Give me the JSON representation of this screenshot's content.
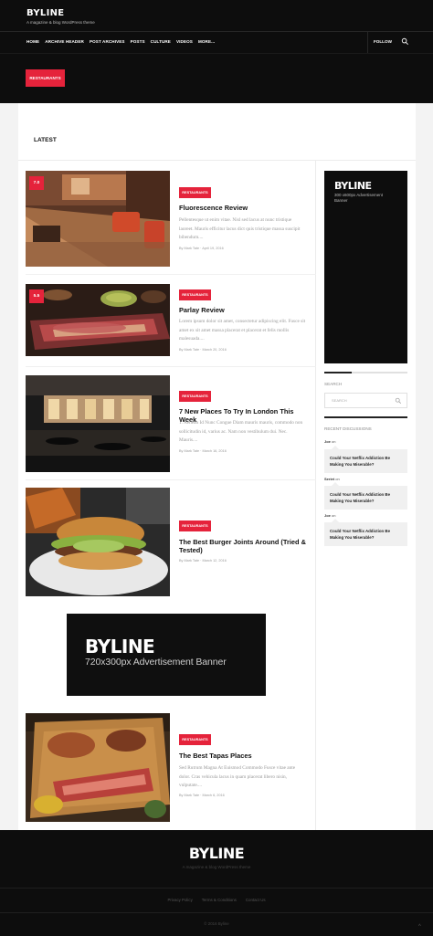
{
  "header": {
    "brand_title": "BYLINE",
    "brand_tagline": "A magazine & blog WordPress theme",
    "nav": [
      "HOME",
      "ARCHIVE HEADER",
      "POST ARCHIVES",
      "POSTS",
      "CULTURE",
      "VIDEOS",
      "MORE..."
    ],
    "follow": "FOLLOW",
    "category_badge": "RESTAURANTS"
  },
  "main": {
    "section_title": "LATEST",
    "posts": [
      {
        "score": "7.0",
        "category": "RESTAURANTS",
        "title": "Fluorescence Review",
        "excerpt": "Pellentesque ut enim vitae. Nisl sed lacus at nunc tristique laoreet. Mauris efficitur lacus dict quis tristique massa suscipit bibendum....",
        "author": "By Mark Tate",
        "date": "April 19, 2016"
      },
      {
        "score": "5.5",
        "category": "RESTAURANTS",
        "title": "Parlay Review",
        "excerpt": "Lorem ipsum dolor sit amet, consectetur adipiscing elit. Fusce sit amet ex sit amet massa placerat et placerat et felis mollis malesuada....",
        "author": "By Mark Tate",
        "date": "March 20, 2016"
      },
      {
        "category": "RESTAURANTS",
        "title": "7 New Places To Try In London This Week",
        "excerpt": "1. Aenean Id Nunc Congue Diam mauris mauris, commodo non sollicitudin id, varius ac. Nam non vestibulum dui. Nec. Mauris....",
        "author": "By Mark Tate",
        "date": "March 16, 2016"
      },
      {
        "category": "RESTAURANTS",
        "title": "The Best Burger Joints Around (Tried & Tested)",
        "author": "By Mark Tate",
        "date": "March 12, 2016"
      },
      {
        "category": "RESTAURANTS",
        "title": "The Best Tapas Places",
        "excerpt": "Sed Rutrum Magna At Euismod Commodo Fusce vitae ante dolor. Cras vehicula lacus in quam placerat libero nisin, vulputate....",
        "author": "By Mark Tate",
        "date": "March 6, 2016"
      }
    ],
    "ad_banner": {
      "title": "BYLINE",
      "subtitle": "720x300px Advertisement Banner"
    }
  },
  "sidebar": {
    "ad": {
      "title": "BYLINE",
      "subtitle": "300 x600px Advertisement Banner"
    },
    "search_heading": "SEARCH",
    "search_placeholder": "SEARCH",
    "recent_heading": "RECENT DISCUSSIONS",
    "discussions": [
      {
        "author": "Joe",
        "on": "on",
        "text": "Could Your Netflix Addiction Be Making You Miserable?"
      },
      {
        "author": "Seriet",
        "on": "on",
        "text": "Could Your Netflix Addiction Be Making You Miserable?"
      },
      {
        "author": "Joe",
        "on": "on",
        "text": "Could Your Netflix Addiction Be Making You Miserable?"
      }
    ]
  },
  "footer": {
    "title": "BYLINE",
    "tagline": "A magazine & blog WordPress theme",
    "links": [
      "Privacy Policy",
      "Terms & Conditions",
      "Contact Us"
    ],
    "copyright": "© 2016 Byline",
    "up_arrow": "^"
  },
  "colors": {
    "accent": "#e5233b",
    "dark": "#0d0d0d"
  }
}
